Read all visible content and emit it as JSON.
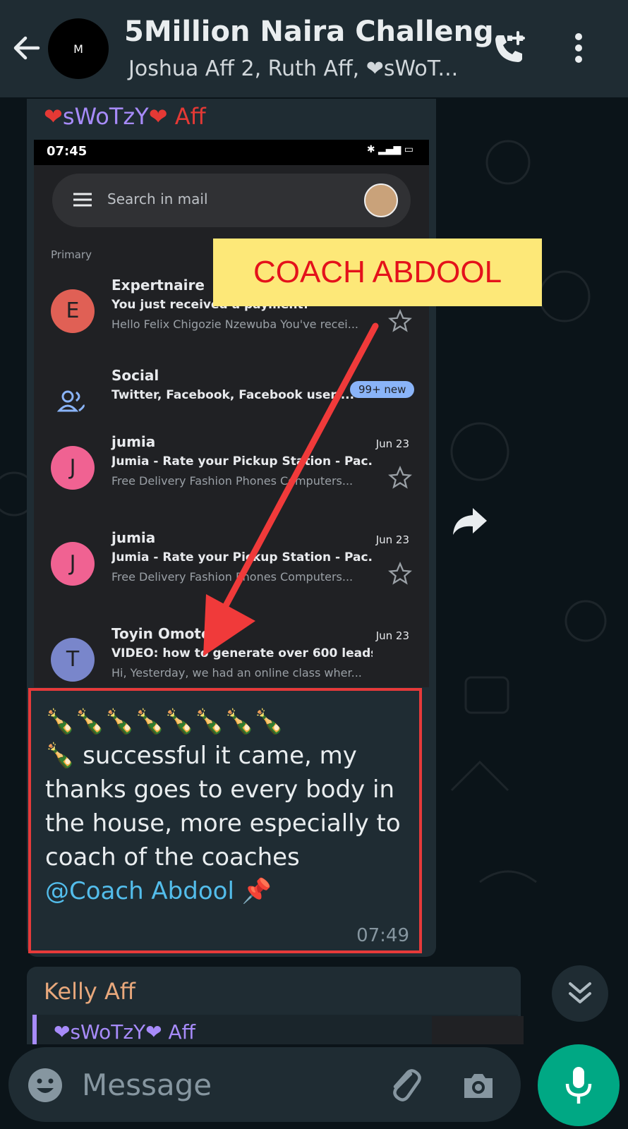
{
  "header": {
    "avatar_letter": "M",
    "title": "5Million Naira Challeng...",
    "subtitle": "Joshua Aff 2,  Ruth Aff, ❤sWoT..."
  },
  "message": {
    "sender_prefix": "❤",
    "sender_name": "sWoTzY",
    "sender_suffix": "❤ Aff",
    "text_emojis": "🍾🍾🍾🍾🍾🍾🍾🍾",
    "text_body": "🍾 successful it came, my thanks goes to every body in the house, more especially to coach of the coaches",
    "mention": "@Coach Abdool",
    "mention_emoji": "📌",
    "time": "07:49"
  },
  "annotation": {
    "label": "COACH ABDOOL"
  },
  "gmail_screenshot": {
    "status_time": "07:45",
    "search_placeholder": "Search in mail",
    "section": "Primary",
    "emails": [
      {
        "avatar": "E",
        "from": "Expertnaire",
        "subject": "You just received a payment!",
        "snippet": "Hello Felix Chigozie Nzewuba You've recei...",
        "date": ""
      },
      {
        "avatar": "",
        "from": "Social",
        "subject": "Twitter, Facebook, Facebook user ...",
        "snippet": "",
        "date": "",
        "badge": "99+ new"
      },
      {
        "avatar": "J",
        "from": "jumia",
        "subject": "Jumia - Rate your Pickup Station - Pac...",
        "snippet": "Free Delivery Fashion Phones Computers...",
        "date": "Jun 23"
      },
      {
        "avatar": "J",
        "from": "jumia",
        "subject": "Jumia - Rate your Pickup Station - Pac...",
        "snippet": "Free Delivery Fashion Phones Computers...",
        "date": "Jun 23"
      },
      {
        "avatar": "T",
        "from": "Toyin Omotoso",
        "subject": "VIDEO: how to generate over 600 leads...",
        "snippet": "Hi, Yesterday, we had an online class wher...",
        "date": "Jun 23"
      }
    ]
  },
  "next_message": {
    "sender": "Kelly Aff",
    "quote": "❤sWoTzY❤ Aff"
  },
  "composer": {
    "placeholder": "Message"
  },
  "colors": {
    "header_bg": "#1f2c33",
    "bubble_bg": "#1f2c33",
    "accent_green": "#00a884",
    "mention_blue": "#53bdeb",
    "highlight_red": "#e63a3a",
    "label_yellow": "#fde878"
  }
}
